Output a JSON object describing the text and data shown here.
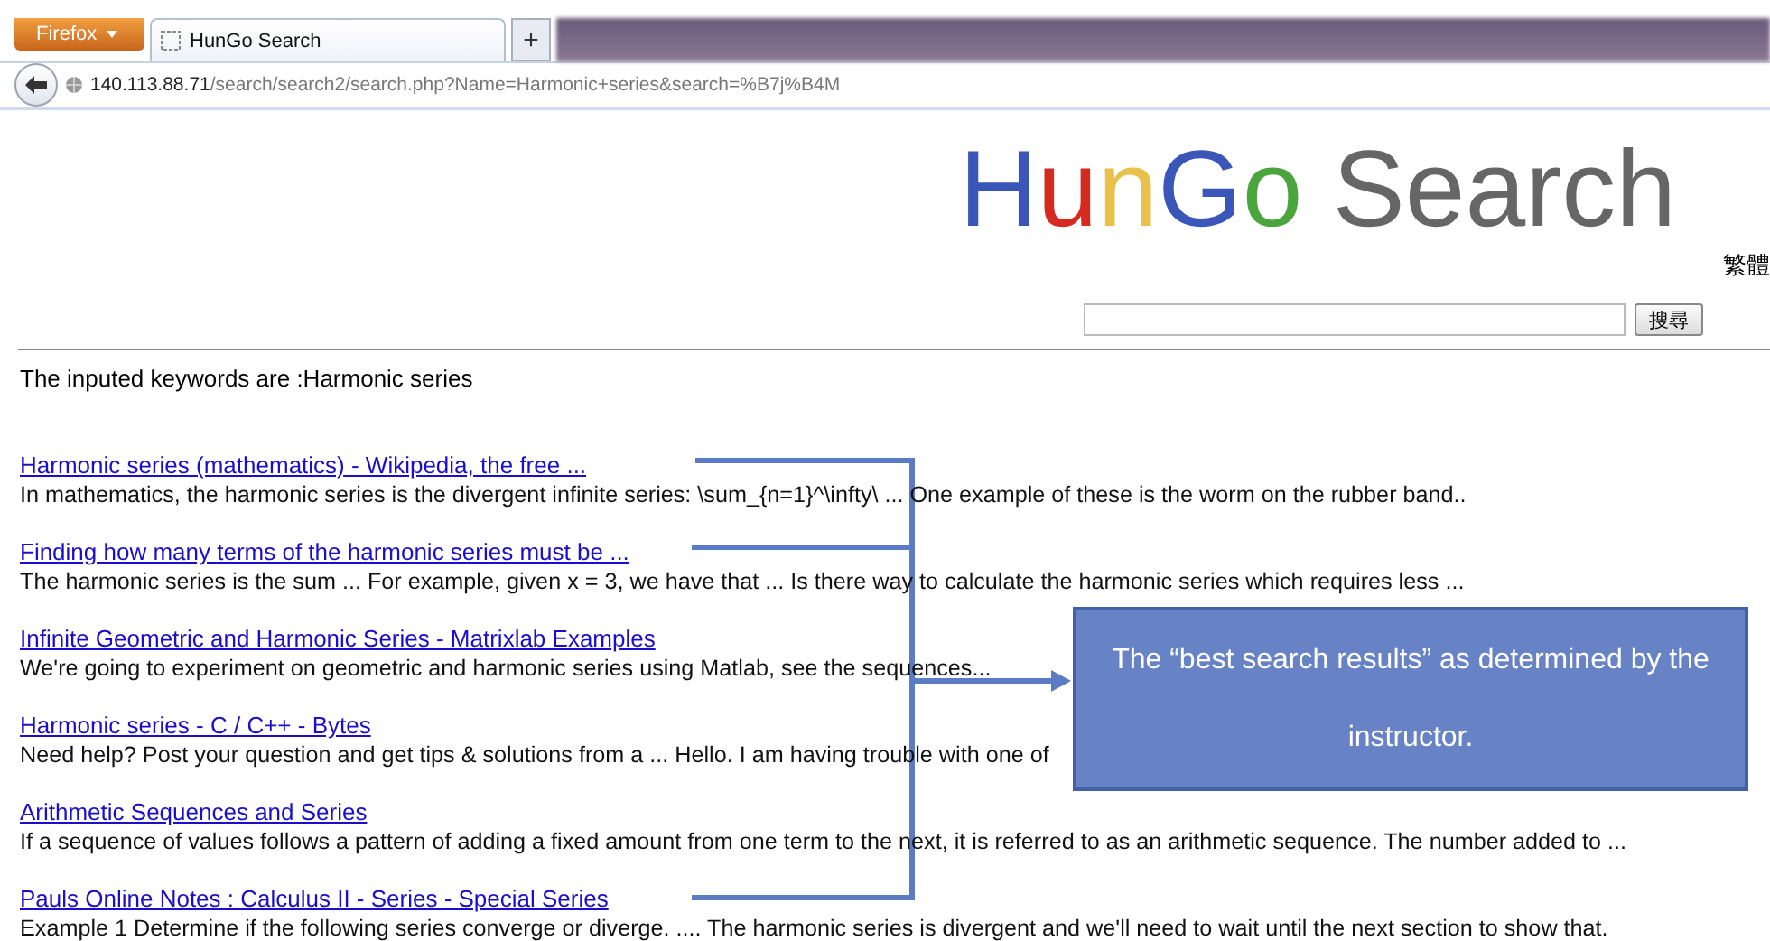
{
  "browser": {
    "menu_button": "Firefox",
    "tab": {
      "title": "HunGo Search"
    },
    "new_tab": "+",
    "address": "**140.113.88.71**/search/search2/search.php?Name=Harmonic+series&search=%B7j%B4M"
  },
  "logo": {
    "words": [
      {
        "letters": [
          {
            "text": "H",
            "color": "#3a56b8"
          },
          {
            "text": "u",
            "color": "#d42a1f"
          },
          {
            "text": "n",
            "color": "#e8c04a"
          },
          {
            "text": "G",
            "color": "#3a56b8"
          },
          {
            "text": "o",
            "color": "#4aa63c"
          }
        ]
      },
      {
        "letters": [
          {
            "text": "Search",
            "color": "#666666"
          }
        ]
      }
    ]
  },
  "language_link": "繁體",
  "search": {
    "button": "搜尋"
  },
  "keywords_line": "The inputed keywords are :Harmonic series",
  "results": [
    {
      "title": "Harmonic series (mathematics) - Wikipedia, the free ...",
      "snippet": "In mathematics, the harmonic series is the divergent infinite series: \\sum_{n=1}^\\infty\\ ... One example of these is the worm on the rubber band.."
    },
    {
      "title": "Finding how many terms of the harmonic series must be ...",
      "snippet": "The harmonic series is the sum ... For example, given x = 3, we have that ... Is there way to calculate the harmonic series which requires less ..."
    },
    {
      "title": "Infinite Geometric and Harmonic Series - Matrixlab Examples",
      "snippet": "We're going to experiment on geometric and harmonic series using Matlab, see the sequences..."
    },
    {
      "title": "Harmonic series - C / C++ - Bytes",
      "snippet": "Need help? Post your question and get tips & solutions from a ... Hello. I am having trouble with one of"
    },
    {
      "title": "Arithmetic Sequences and Series",
      "snippet": "If a sequence of values follows a pattern of adding a fixed amount from one term to the next, it is referred to as an arithmetic sequence. The number added to ..."
    },
    {
      "title": "Pauls Online Notes : Calculus II - Series - Special Series",
      "snippet": "Example 1 Determine if the following series converge or diverge. .... The harmonic series is divergent and we'll need to wait until the next section to show that."
    }
  ],
  "annotation": {
    "callout": "The “best search results” as determined by the instructor."
  }
}
